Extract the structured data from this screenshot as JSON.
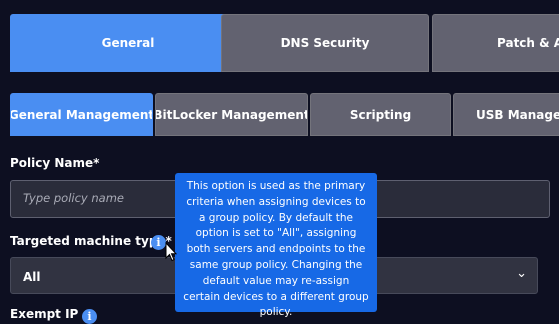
{
  "top_tabs": [
    {
      "label": "General",
      "active": true
    },
    {
      "label": "DNS Security",
      "active": false
    },
    {
      "label": "Patch & Asset",
      "active": false
    }
  ],
  "sub_tabs": [
    {
      "label": "General Management",
      "active": true
    },
    {
      "label": "BitLocker Management",
      "active": false
    },
    {
      "label": "Scripting",
      "active": false
    },
    {
      "label": "USB Management",
      "active": false
    }
  ],
  "policy_name": {
    "label": "Policy Name*",
    "placeholder": "Type policy name"
  },
  "machine_type": {
    "label": "Targeted machine type*",
    "value": "All"
  },
  "next_field_label": "Exempt IP",
  "tooltip": {
    "text": "This option is used as the primary criteria when assigning devices to a group policy. By default the option is set to \"All\", assigning both servers and endpoints to the same group policy. Changing the default value may re-assign certain devices to a different group policy."
  },
  "icons": {
    "info": "info-icon",
    "chevron": "chevron-down-icon",
    "cursor": "mouse-pointer-icon"
  },
  "colors": {
    "background": "#0d0f21",
    "active_tab": "#4a8ef2",
    "inactive_tab": "#626270",
    "tooltip": "#1769e6"
  }
}
